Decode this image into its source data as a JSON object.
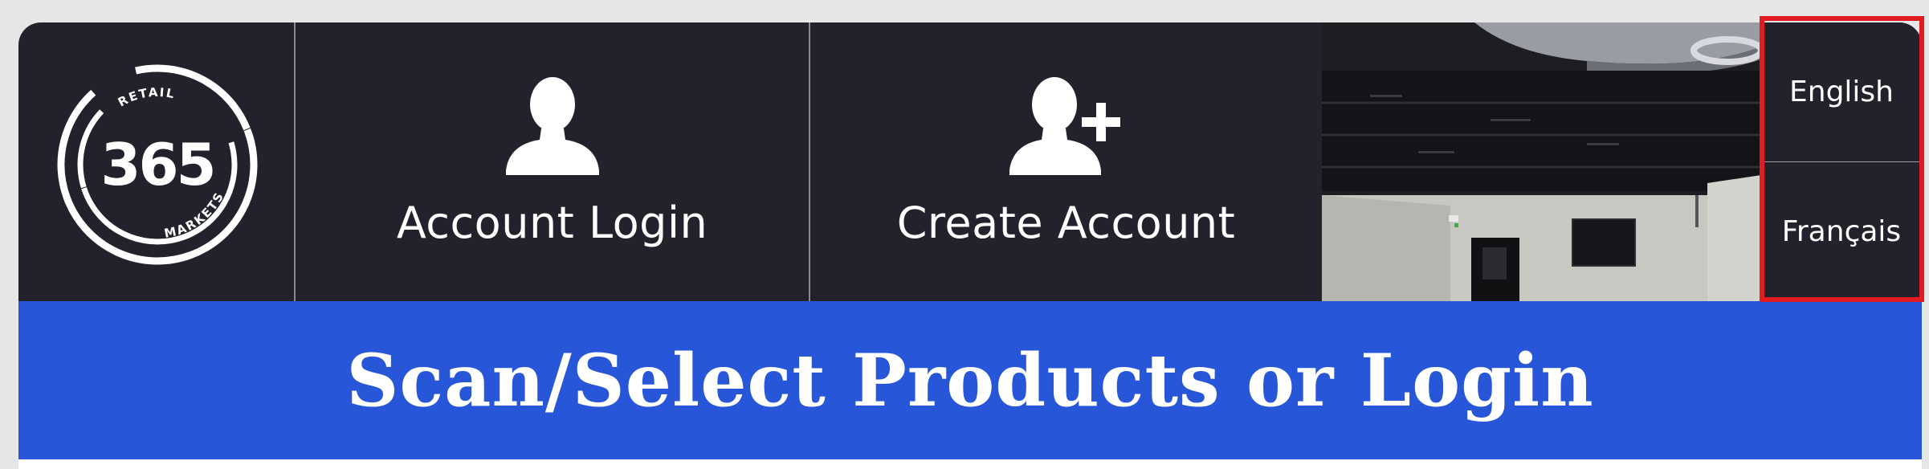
{
  "logo": {
    "number": "365",
    "top_text": "RETAIL",
    "bottom_text": "MARKETS",
    "icon": "365-retail-markets-logo"
  },
  "nav": {
    "login": {
      "label": "Account Login",
      "icon": "person-icon"
    },
    "create": {
      "label": "Create Account",
      "icon": "person-add-icon"
    }
  },
  "language": {
    "english": "English",
    "french": "Français"
  },
  "banner": {
    "title": "Scan/Select Products or Login"
  },
  "colors": {
    "header_bg": "#23212c",
    "banner_bg": "#2856d9",
    "highlight": "#e21b23",
    "text": "#ffffff"
  }
}
